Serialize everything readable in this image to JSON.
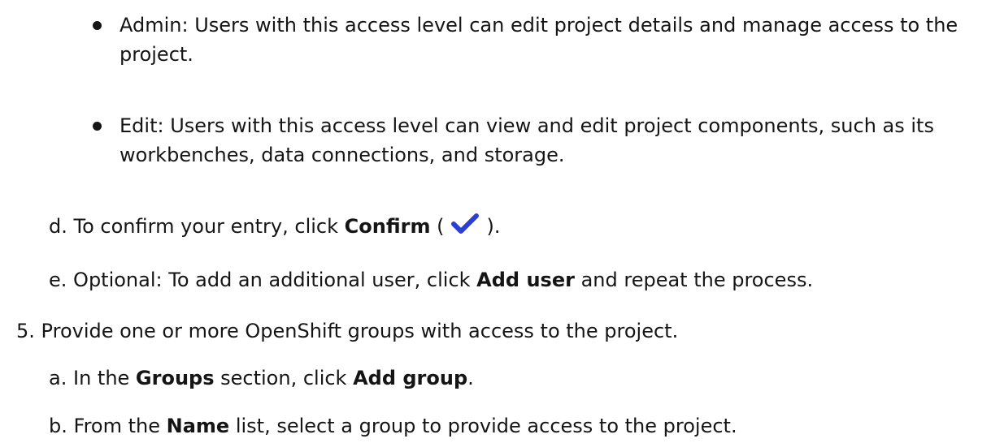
{
  "bullets": [
    {
      "lines": [
        "Admin: Users with this access level can edit project details and manage access to the",
        "project."
      ]
    },
    {
      "lines": [
        "Edit: Users with this access level can view and edit project components, such as its",
        "workbenches, data connections, and storage."
      ]
    }
  ],
  "step_d": {
    "marker": "d.",
    "prefix": "To confirm your entry, click ",
    "bold": "Confirm",
    "paren_open": " (",
    "icon": "checkmark-icon",
    "icon_color": "#2b3fd6",
    "paren_close": ")."
  },
  "step_e": {
    "marker": "e.",
    "prefix": "Optional: To add an additional user, click ",
    "bold": "Add user",
    "suffix": " and repeat the process."
  },
  "step_5": {
    "marker": "5.",
    "text": "Provide one or more OpenShift groups with access to the project."
  },
  "step_5a": {
    "marker": "a.",
    "prefix": "In the ",
    "bold1": "Groups",
    "middle": " section, click ",
    "bold2": "Add group",
    "suffix": "."
  },
  "step_5b": {
    "marker": "b.",
    "prefix": "From the ",
    "bold": "Name",
    "suffix": " list, select a group to provide access to the project."
  }
}
